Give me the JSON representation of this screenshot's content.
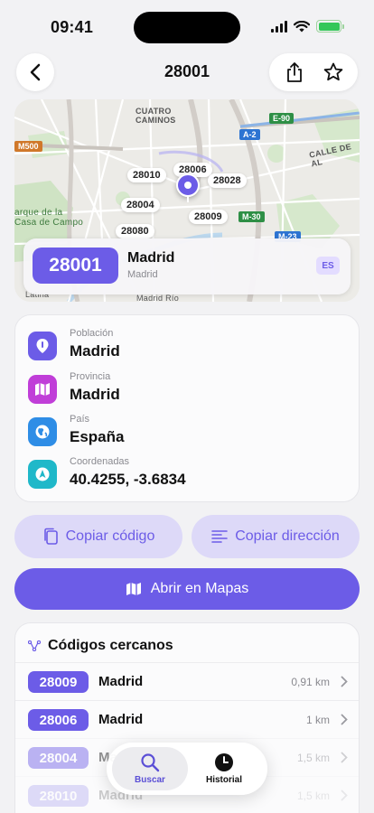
{
  "status": {
    "time": "09:41"
  },
  "nav": {
    "title": "28001",
    "back_icon": "chevron-left-icon",
    "share_icon": "share-icon",
    "favorite_icon": "star-icon"
  },
  "map": {
    "district_label_1": "CUATRO",
    "district_label_2": "CAMINOS",
    "street_label": "CALLE DE AL",
    "park_label_1": "arque de la",
    "park_label_2": "Casa de Campo",
    "latina_label": "Latina",
    "madrid_rio_label": "Madrid Río",
    "road_signs": [
      "M500",
      "A-2",
      "E-90",
      "M-30",
      "M-23"
    ],
    "postal_pins": [
      "28010",
      "28006",
      "28028",
      "28004",
      "28009",
      "28080"
    ],
    "overlay": {
      "code": "28001",
      "city": "Madrid",
      "subtitle": "Madrid",
      "country": "ES"
    }
  },
  "info": {
    "rows": [
      {
        "label": "Población",
        "value": "Madrid",
        "icon": "location-pin-icon",
        "color": "#6c5ce7"
      },
      {
        "label": "Provincia",
        "value": "Madrid",
        "icon": "map-icon",
        "color": "#c03ed8"
      },
      {
        "label": "País",
        "value": "España",
        "icon": "globe-icon",
        "color": "#2e8de6"
      },
      {
        "label": "Coordenadas",
        "value": "40.4255, -3.6834",
        "icon": "navigation-icon",
        "color": "#1fb8c9"
      }
    ]
  },
  "actions": {
    "copy_code": "Copiar código",
    "copy_address": "Copiar dirección",
    "open_maps": "Abrir en Mapas"
  },
  "nearby": {
    "title": "Códigos cercanos",
    "items": [
      {
        "code": "28009",
        "city": "Madrid",
        "distance": "0,91 km"
      },
      {
        "code": "28006",
        "city": "Madrid",
        "distance": "1 km"
      },
      {
        "code": "28004",
        "city": "Madrid",
        "distance": "1,5 km"
      },
      {
        "code": "28010",
        "city": "Madrid",
        "distance": "1,5 km"
      }
    ]
  },
  "tabs": [
    {
      "label": "Buscar",
      "icon": "search-icon",
      "active": true
    },
    {
      "label": "Historial",
      "icon": "clock-icon",
      "active": false
    }
  ],
  "colors": {
    "accent": "#6c5ce7",
    "accent_soft": "#ddd9f8"
  }
}
